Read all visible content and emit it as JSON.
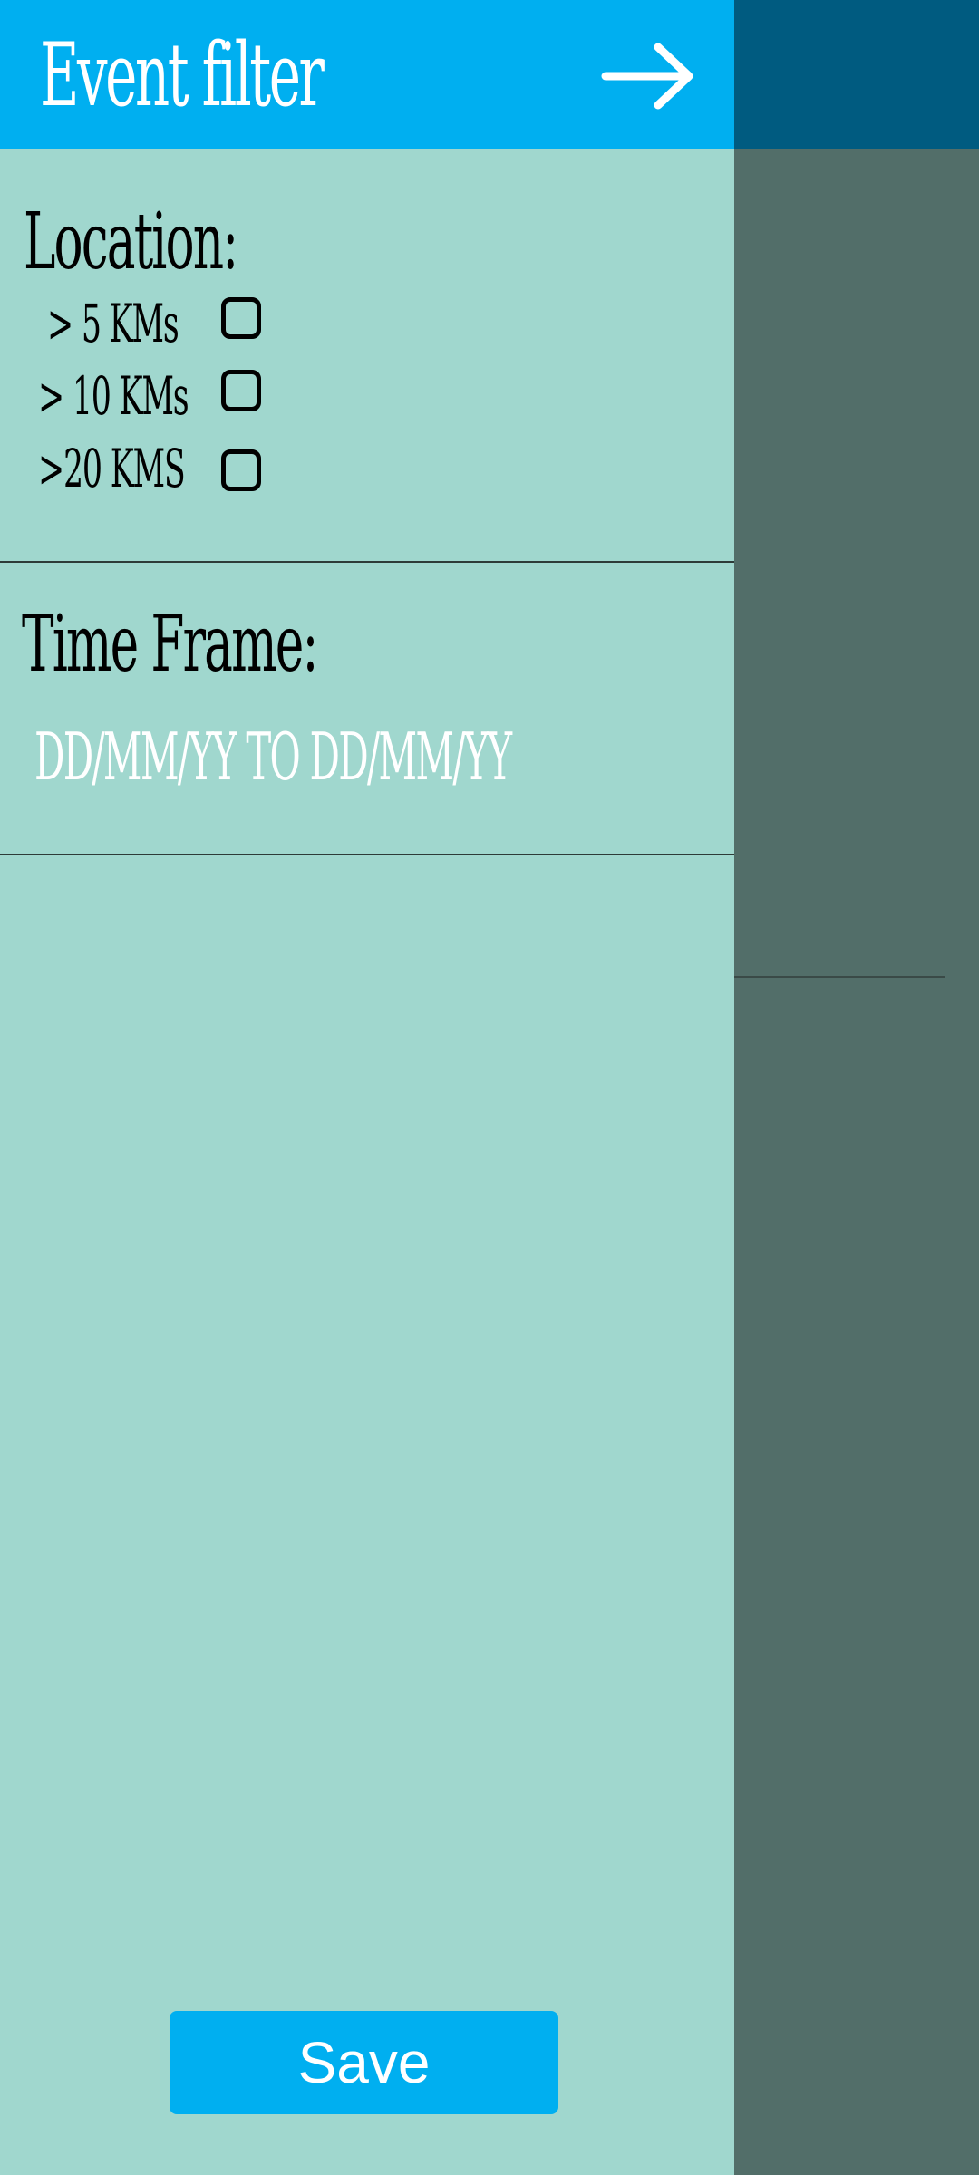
{
  "header": {
    "title": "Event filter",
    "close_icon": "arrow-right-icon"
  },
  "location": {
    "title": "Location:",
    "options": [
      {
        "label": "> 5 KMs",
        "checked": false
      },
      {
        "label": "> 10 KMs",
        "checked": false
      },
      {
        "label": ">20 KMS",
        "checked": false
      }
    ]
  },
  "time_frame": {
    "title": "Time Frame:",
    "placeholder": "DD/MM/YY TO DD/MM/YY"
  },
  "actions": {
    "save_label": "Save"
  },
  "colors": {
    "accent": "#00aff0",
    "drawer_background": "#a0d7ce",
    "scrim": "#526e69",
    "scrim_header": "#005b80"
  }
}
